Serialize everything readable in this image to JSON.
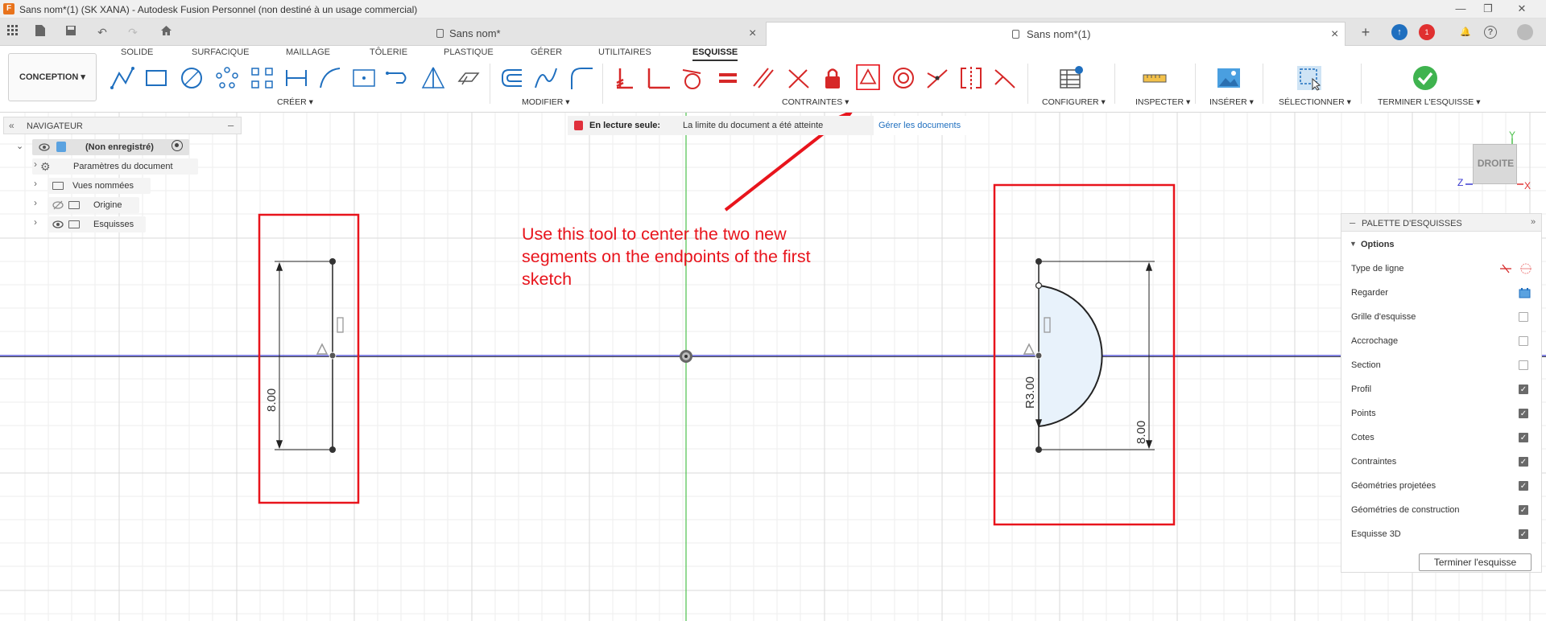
{
  "window": {
    "title": "Sans nom*(1) (SK XANA) - Autodesk Fusion Personnel (non destiné à un usage commercial)",
    "app_icon": "F",
    "controls": [
      "—",
      "❐",
      "✕"
    ]
  },
  "tabs": {
    "items": [
      {
        "label": "Sans nom*",
        "active": false,
        "locked": true
      },
      {
        "label": "Sans nom*(1)",
        "active": true,
        "locked": true
      }
    ],
    "new_tab": "+",
    "notification_count": "1"
  },
  "ribbon": {
    "workspace": "CONCEPTION",
    "tabs": [
      "SOLIDE",
      "SURFACIQUE",
      "MAILLAGE",
      "TÔLERIE",
      "PLASTIQUE",
      "GÉRER",
      "UTILITAIRES",
      "ESQUISSE"
    ],
    "active_tab": "ESQUISSE",
    "groups": {
      "creer": "CRÉER",
      "modifier": "MODIFIER",
      "contraintes": "CONTRAINTES",
      "configurer": "CONFIGURER",
      "inspecter": "INSPECTER",
      "inserer": "INSÉRER",
      "selectionner": "SÉLECTIONNER",
      "terminer": "TERMINER L'ESQUISSE"
    },
    "colors": {
      "accent": "#1f6fbf",
      "highlight": "#e8141c",
      "finish": "#3fb34f"
    }
  },
  "navigator": {
    "title": "NAVIGATEUR",
    "root": "(Non enregistré)",
    "items": [
      "Paramètres du document",
      "Vues nommées",
      "Origine",
      "Esquisses"
    ]
  },
  "readonly_banner": {
    "label": "En lecture seule:",
    "message": "La limite du document a été atteinte",
    "link": "Gérer les documents"
  },
  "annotation": {
    "text": "Use this tool to center the two new segments on the endpoints of the first sketch",
    "line1": "Use this tool to center the two new",
    "line2": "segments on the endpoints of the first",
    "line3": "sketch"
  },
  "sketch": {
    "dim_left": "8.00",
    "dim_right": "8.00",
    "radius": "R3.00"
  },
  "viewcube": {
    "face": "DROITE",
    "axes": [
      "Y",
      "Z",
      "X"
    ]
  },
  "palette": {
    "title": "PALETTE D'ESQUISSES",
    "options_title": "Options",
    "rows": [
      {
        "label": "Type de ligne",
        "kind": "icon"
      },
      {
        "label": "Regarder",
        "kind": "icon"
      },
      {
        "label": "Grille d'esquisse",
        "kind": "checkbox",
        "checked": false
      },
      {
        "label": "Accrochage",
        "kind": "checkbox",
        "checked": false
      },
      {
        "label": "Section",
        "kind": "checkbox",
        "checked": false
      },
      {
        "label": "Profil",
        "kind": "checkbox",
        "checked": true
      },
      {
        "label": "Points",
        "kind": "checkbox",
        "checked": true
      },
      {
        "label": "Cotes",
        "kind": "checkbox",
        "checked": true
      },
      {
        "label": "Contraintes",
        "kind": "checkbox",
        "checked": true
      },
      {
        "label": "Géométries projetées",
        "kind": "checkbox",
        "checked": true
      },
      {
        "label": "Géométries de construction",
        "kind": "checkbox",
        "checked": true
      },
      {
        "label": "Esquisse 3D",
        "kind": "checkbox",
        "checked": true
      }
    ],
    "finish_button": "Terminer l'esquisse"
  }
}
